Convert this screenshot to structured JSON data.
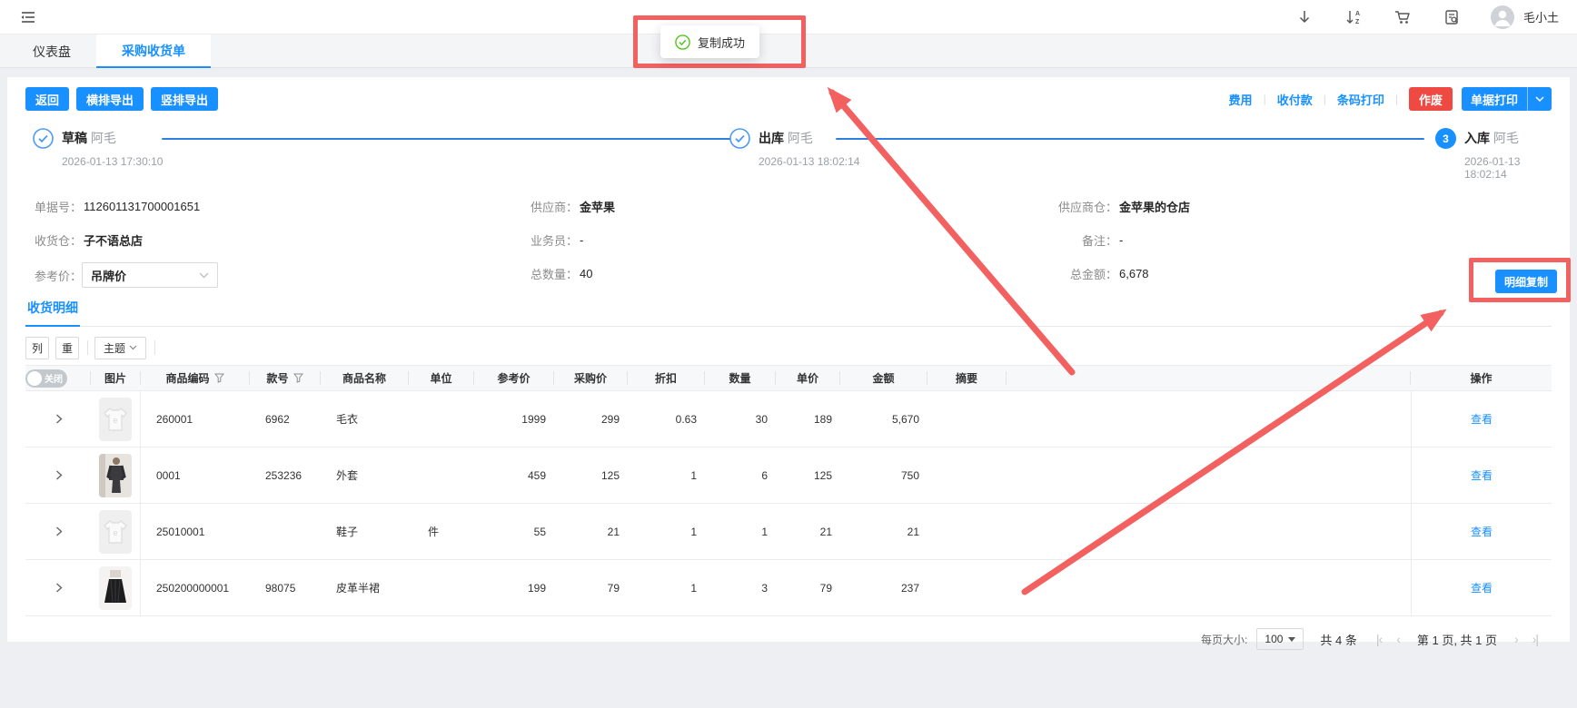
{
  "colors": {
    "primary": "#1890ff",
    "danger_red": "#ef4a42",
    "annotation_red": "#f2605f",
    "success_green": "#52c41a",
    "step_line_blue": "#2e7fe0"
  },
  "topbar": {
    "user_name": "毛小土",
    "icons": [
      "menu-fold-icon",
      "download-icon",
      "sort-a-z-icon",
      "cart-icon",
      "order-search-icon",
      "avatar"
    ]
  },
  "tabs": [
    {
      "label": "仪表盘",
      "active": false
    },
    {
      "label": "采购收货单",
      "active": true
    }
  ],
  "toast": {
    "message": "复制成功"
  },
  "toolbar": {
    "back": "返回",
    "export_horizontal": "横排导出",
    "export_vertical": "竖排导出",
    "links": [
      "费用",
      "收付款",
      "条码打印"
    ],
    "void": "作废",
    "print": "单据打印"
  },
  "steps": [
    {
      "name": "草稿",
      "user": "阿毛",
      "time": "2026-01-13 17:30:10",
      "marker": "check"
    },
    {
      "name": "出库",
      "user": "阿毛",
      "time": "2026-01-13 18:02:14",
      "marker": "check"
    },
    {
      "name": "入库",
      "user": "阿毛",
      "time": "2026-01-13 18:02:14",
      "marker": "3"
    }
  ],
  "fields": {
    "doc_no": {
      "label": "单据号",
      "value": "112601131700001651"
    },
    "supplier": {
      "label": "供应商",
      "value": "金苹果"
    },
    "supplier_wh": {
      "label": "供应商仓",
      "value": "金苹果的仓店"
    },
    "receive_wh": {
      "label": "收货仓",
      "value": "子不语总店"
    },
    "salesman": {
      "label": "业务员",
      "value": "-"
    },
    "remark": {
      "label": "备注",
      "value": "-"
    },
    "ref_price": {
      "label": "参考价",
      "value": "吊牌价"
    },
    "total_qty": {
      "label": "总数量",
      "value": "40"
    },
    "total_amount": {
      "label": "总金额",
      "value": "6,678"
    }
  },
  "detail_section": {
    "tab": "收货明细",
    "copy_button": "明细复制",
    "controls": {
      "columns": "列",
      "weight": "重",
      "theme": "主题"
    }
  },
  "table": {
    "toggle_label": "关闭",
    "headers": [
      "图片",
      "商品编码",
      "款号",
      "商品名称",
      "单位",
      "参考价",
      "采购价",
      "折扣",
      "数量",
      "单价",
      "金额",
      "摘要",
      "操作"
    ],
    "action_label": "查看",
    "rows": [
      {
        "img": "tshirt",
        "code": "260001",
        "style_no": "6962",
        "name": "毛衣",
        "unit": "",
        "ref_price": "1999",
        "purchase_price": "299",
        "discount": "0.63",
        "qty": "30",
        "unit_price": "189",
        "amount": "5,670",
        "summary": ""
      },
      {
        "img": "jacket",
        "code": "0001",
        "style_no": "253236",
        "name": "外套",
        "unit": "",
        "ref_price": "459",
        "purchase_price": "125",
        "discount": "1",
        "qty": "6",
        "unit_price": "125",
        "amount": "750",
        "summary": ""
      },
      {
        "img": "tshirt",
        "code": "25010001",
        "style_no": "",
        "name": "鞋子",
        "unit": "件",
        "ref_price": "55",
        "purchase_price": "21",
        "discount": "1",
        "qty": "1",
        "unit_price": "21",
        "amount": "21",
        "summary": ""
      },
      {
        "img": "skirt",
        "code": "250200000001",
        "style_no": "98075",
        "name": "皮革半裙",
        "unit": "",
        "ref_price": "199",
        "purchase_price": "79",
        "discount": "1",
        "qty": "3",
        "unit_price": "79",
        "amount": "237",
        "summary": ""
      }
    ]
  },
  "pagination": {
    "page_size_label": "每页大小:",
    "page_size": "100",
    "total": "共 4 条",
    "page_info": "第 1 页, 共 1 页"
  }
}
